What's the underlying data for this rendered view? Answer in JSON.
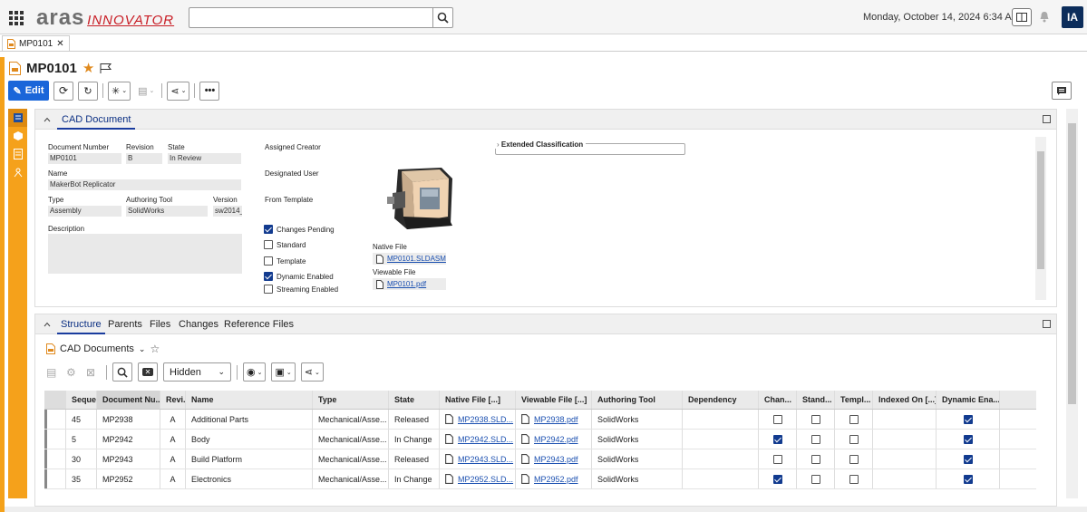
{
  "app": {
    "logo_main": "aras",
    "logo_sub": "INNOVATOR",
    "datetime": "Monday, October 14, 2024 6:34 AM",
    "user_initials": "IA",
    "search_placeholder": ""
  },
  "tabs": [
    {
      "label": "MP0101"
    }
  ],
  "item": {
    "title": "MP0101",
    "edit_label": "Edit"
  },
  "form": {
    "tab_label": "CAD Document",
    "document_number_label": "Document Number",
    "document_number": "MP0101",
    "revision_label": "Revision",
    "revision": "B",
    "state_label": "State",
    "state": "In Review",
    "name_label": "Name",
    "name": "MakerBot Replicator",
    "type_label": "Type",
    "type": "Assembly",
    "authoring_tool_label": "Authoring Tool",
    "authoring_tool": "SolidWorks",
    "version_label": "Version",
    "version": "sw2014_",
    "description_label": "Description",
    "assigned_creator_label": "Assigned Creator",
    "designated_user_label": "Designated User",
    "from_template_label": "From Template",
    "changes_pending_label": "Changes Pending",
    "changes_pending": true,
    "standard_label": "Standard",
    "standard": false,
    "template_label": "Template",
    "template": false,
    "dynamic_enabled_label": "Dynamic Enabled",
    "dynamic_enabled": true,
    "streaming_enabled_label": "Streaming Enabled",
    "streaming_enabled": false,
    "native_file_label": "Native File",
    "native_file": "MP0101.SLDASM",
    "viewable_file_label": "Viewable File",
    "viewable_file": "MP0101.pdf",
    "extended_classification_label": "Extended Classification"
  },
  "relationships": {
    "tabs": [
      "Structure",
      "Parents",
      "Files",
      "Changes",
      "Reference Files"
    ],
    "active_tab": "Structure",
    "grid_title": "CAD Documents",
    "view_select": "Hidden",
    "columns": [
      "Seque...",
      "Document Nu...",
      "Revi...",
      "Name",
      "Type",
      "State",
      "Native File [...]",
      "Viewable File [...]",
      "Authoring Tool",
      "Dependency",
      "Chan...",
      "Stand...",
      "Templ...",
      "Indexed On [...]",
      "Dynamic Ena..."
    ],
    "rows": [
      {
        "seq": "45",
        "docnum": "MP2938",
        "rev": "A",
        "name": "Additional Parts",
        "type": "Mechanical/Asse...",
        "state": "Released",
        "native": "MP2938.SLD...",
        "viewable": "MP2938.pdf",
        "tool": "SolidWorks",
        "dependency": "",
        "changes": false,
        "standard": false,
        "template": false,
        "indexed": "",
        "dynamic": true
      },
      {
        "seq": "5",
        "docnum": "MP2942",
        "rev": "A",
        "name": "Body",
        "type": "Mechanical/Asse...",
        "state": "In Change",
        "native": "MP2942.SLD...",
        "viewable": "MP2942.pdf",
        "tool": "SolidWorks",
        "dependency": "",
        "changes": true,
        "standard": false,
        "template": false,
        "indexed": "",
        "dynamic": true
      },
      {
        "seq": "30",
        "docnum": "MP2943",
        "rev": "A",
        "name": "Build Platform",
        "type": "Mechanical/Asse...",
        "state": "Released",
        "native": "MP2943.SLD...",
        "viewable": "MP2943.pdf",
        "tool": "SolidWorks",
        "dependency": "",
        "changes": false,
        "standard": false,
        "template": false,
        "indexed": "",
        "dynamic": true
      },
      {
        "seq": "35",
        "docnum": "MP2952",
        "rev": "A",
        "name": "Electronics",
        "type": "Mechanical/Asse...",
        "state": "In Change",
        "native": "MP2952.SLD...",
        "viewable": "MP2952.pdf",
        "tool": "SolidWorks",
        "dependency": "",
        "changes": true,
        "standard": false,
        "template": false,
        "indexed": "",
        "dynamic": true
      }
    ]
  }
}
